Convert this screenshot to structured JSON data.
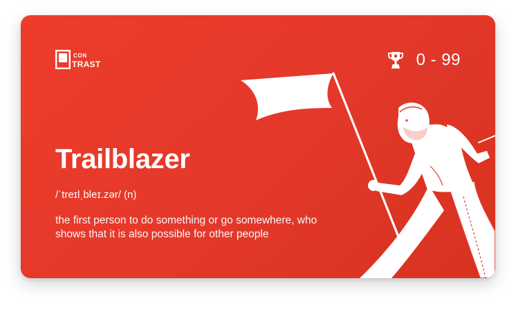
{
  "brand": {
    "logo_top": "CON",
    "logo_bottom": "TRAST",
    "icons": {
      "logo": "contrast-logo-mark",
      "score": "trophy-icon"
    }
  },
  "score": {
    "range": "0 - 99"
  },
  "entry": {
    "word": "Trailblazer",
    "pronunciation": "/ˈtreɪlˌbleɪ.zər/ (n)",
    "definition": "the first person to do something or go somewhere, who shows that it is also possible for other people"
  },
  "colors": {
    "card_background": "#e3382a",
    "text": "#ffffff"
  }
}
